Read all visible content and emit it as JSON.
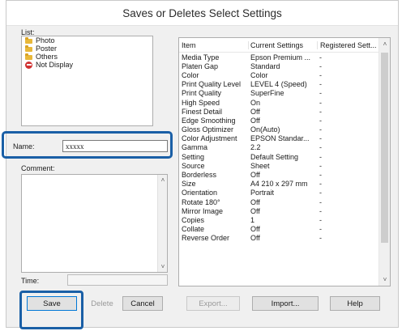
{
  "dialog": {
    "title": "Saves or Deletes Select Settings"
  },
  "list": {
    "label": "List:",
    "items": [
      {
        "label": "Photo",
        "icon": "folder-icon"
      },
      {
        "label": "Poster",
        "icon": "folder-icon"
      },
      {
        "label": "Others",
        "icon": "folder-icon"
      },
      {
        "label": "Not Display",
        "icon": "block-icon"
      }
    ]
  },
  "name": {
    "label": "Name:",
    "value": "xxxxx"
  },
  "comment": {
    "label": "Comment:",
    "value": ""
  },
  "time": {
    "label": "Time:",
    "value": ""
  },
  "buttons": {
    "save": "Save",
    "delete": "Delete",
    "cancel": "Cancel",
    "export": "Export...",
    "import": "Import...",
    "help": "Help"
  },
  "table": {
    "headers": [
      "Item",
      "Current Settings",
      "Registered Sett..."
    ],
    "rows": [
      [
        "Media Type",
        "Epson Premium ...",
        "-"
      ],
      [
        "Platen Gap",
        "Standard",
        "-"
      ],
      [
        "Color",
        "Color",
        "-"
      ],
      [
        "Print Quality Level",
        "LEVEL 4 (Speed)",
        "-"
      ],
      [
        "Print Quality",
        "SuperFine",
        "-"
      ],
      [
        "High Speed",
        "On",
        "-"
      ],
      [
        "Finest Detail",
        "Off",
        "-"
      ],
      [
        "Edge Smoothing",
        "Off",
        "-"
      ],
      [
        "Gloss Optimizer",
        "On(Auto)",
        "-"
      ],
      [
        "Color Adjustment",
        "EPSON Standar...",
        "-"
      ],
      [
        "Gamma",
        "2.2",
        "-"
      ],
      [
        "Setting",
        "Default Setting",
        "-"
      ],
      [
        "Source",
        "Sheet",
        "-"
      ],
      [
        "Borderless",
        "Off",
        "-"
      ],
      [
        "Size",
        "A4 210 x 297 mm",
        "-"
      ],
      [
        "Orientation",
        "Portrait",
        "-"
      ],
      [
        "Rotate 180°",
        "Off",
        "-"
      ],
      [
        "Mirror Image",
        "Off",
        "-"
      ],
      [
        "Copies",
        "1",
        "-"
      ],
      [
        "Collate",
        "Off",
        "-"
      ],
      [
        "Reverse Order",
        "Off",
        "-"
      ]
    ]
  }
}
